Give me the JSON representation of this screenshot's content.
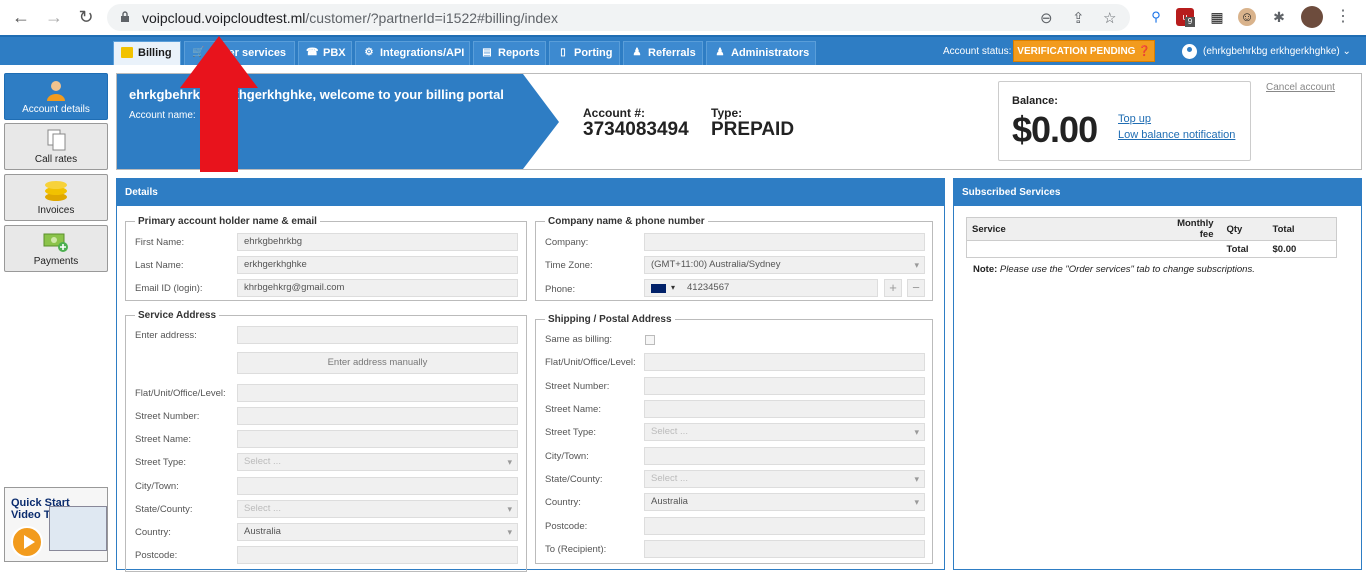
{
  "browser": {
    "url_host": "voipcloud.voipcloudtest.ml",
    "url_path": "/customer/?partnerId=i1522#billing/index",
    "ext_badge": "9"
  },
  "nav": {
    "tabs": [
      {
        "label": "Billing",
        "icon": "folder-icon"
      },
      {
        "label": "Order services",
        "icon": "cart-icon"
      },
      {
        "label": "PBX",
        "icon": "pbx-icon"
      },
      {
        "label": "Integrations/API",
        "icon": "gear-icon"
      },
      {
        "label": "Reports",
        "icon": "report-icon"
      },
      {
        "label": "Porting",
        "icon": "phone-icon"
      },
      {
        "label": "Referrals",
        "icon": "person-icon"
      },
      {
        "label": "Administrators",
        "icon": "admin-icon"
      }
    ],
    "account_status_label": "Account status:",
    "account_status_value": "VERIFICATION PENDING",
    "user_name": "(ehrkgbehrkbg erkhgerkhghke)"
  },
  "sidebar": {
    "items": [
      {
        "label": "Account details"
      },
      {
        "label": "Call rates"
      },
      {
        "label": "Invoices"
      },
      {
        "label": "Payments"
      }
    ],
    "tutorial_line1": "Quick Start",
    "tutorial_line2": "Video Tutorial"
  },
  "banner": {
    "welcome": "ehrkgbehrkbg erkhgerkhghke, welcome to your billing portal",
    "account_name_label": "Account name:",
    "account_num_label": "Account #:",
    "account_num": "3734083494",
    "type_label": "Type:",
    "type_value": "PREPAID",
    "balance_label": "Balance:",
    "balance_value": "$0.00",
    "top_up": "Top up",
    "low_balance": "Low balance notification",
    "cancel_account": "Cancel account"
  },
  "details": {
    "title": "Details",
    "primary": {
      "legend": "Primary account holder name & email",
      "first_name_label": "First Name:",
      "first_name": "ehrkgbehrkbg",
      "last_name_label": "Last Name:",
      "last_name": "erkhgerkhghke",
      "email_label": "Email ID (login):",
      "email": "khrbgehkrg@gmail.com"
    },
    "company": {
      "legend": "Company name & phone number",
      "company_label": "Company:",
      "company": "",
      "timezone_label": "Time Zone:",
      "timezone": "(GMT+11:00) Australia/Sydney",
      "phone_label": "Phone:",
      "phone": "41234567"
    },
    "service": {
      "legend": "Service Address",
      "enter_address_label": "Enter address:",
      "manual_button": "Enter address manually",
      "flat_label": "Flat/Unit/Office/Level:",
      "street_number_label": "Street Number:",
      "street_name_label": "Street Name:",
      "street_type_label": "Street Type:",
      "street_type_placeholder": "Select ...",
      "city_label": "City/Town:",
      "state_label": "State/County:",
      "state_placeholder": "Select ...",
      "country_label": "Country:",
      "country": "Australia",
      "postcode_label": "Postcode:"
    },
    "shipping": {
      "legend": "Shipping / Postal Address",
      "same_label": "Same as billing:",
      "flat_label": "Flat/Unit/Office/Level:",
      "street_number_label": "Street Number:",
      "street_name_label": "Street Name:",
      "street_type_label": "Street Type:",
      "street_type_placeholder": "Select ...",
      "city_label": "City/Town:",
      "state_label": "State/County:",
      "state_placeholder": "Select ...",
      "country_label": "Country:",
      "country": "Australia",
      "postcode_label": "Postcode:",
      "recipient_label": "To (Recipient):"
    }
  },
  "subs": {
    "title": "Subscribed Services",
    "col_service": "Service",
    "col_fee": "Monthly fee",
    "col_qty": "Qty",
    "col_total": "Total",
    "total_label": "Total",
    "total_value": "$0.00",
    "note_label": "Note:",
    "note_text": "Please use the \"Order services\" tab to change subscriptions."
  },
  "colors": {
    "brand_blue": "#2e7dc4",
    "status_orange": "#f29b1d",
    "annotation_red": "#e8131c"
  }
}
